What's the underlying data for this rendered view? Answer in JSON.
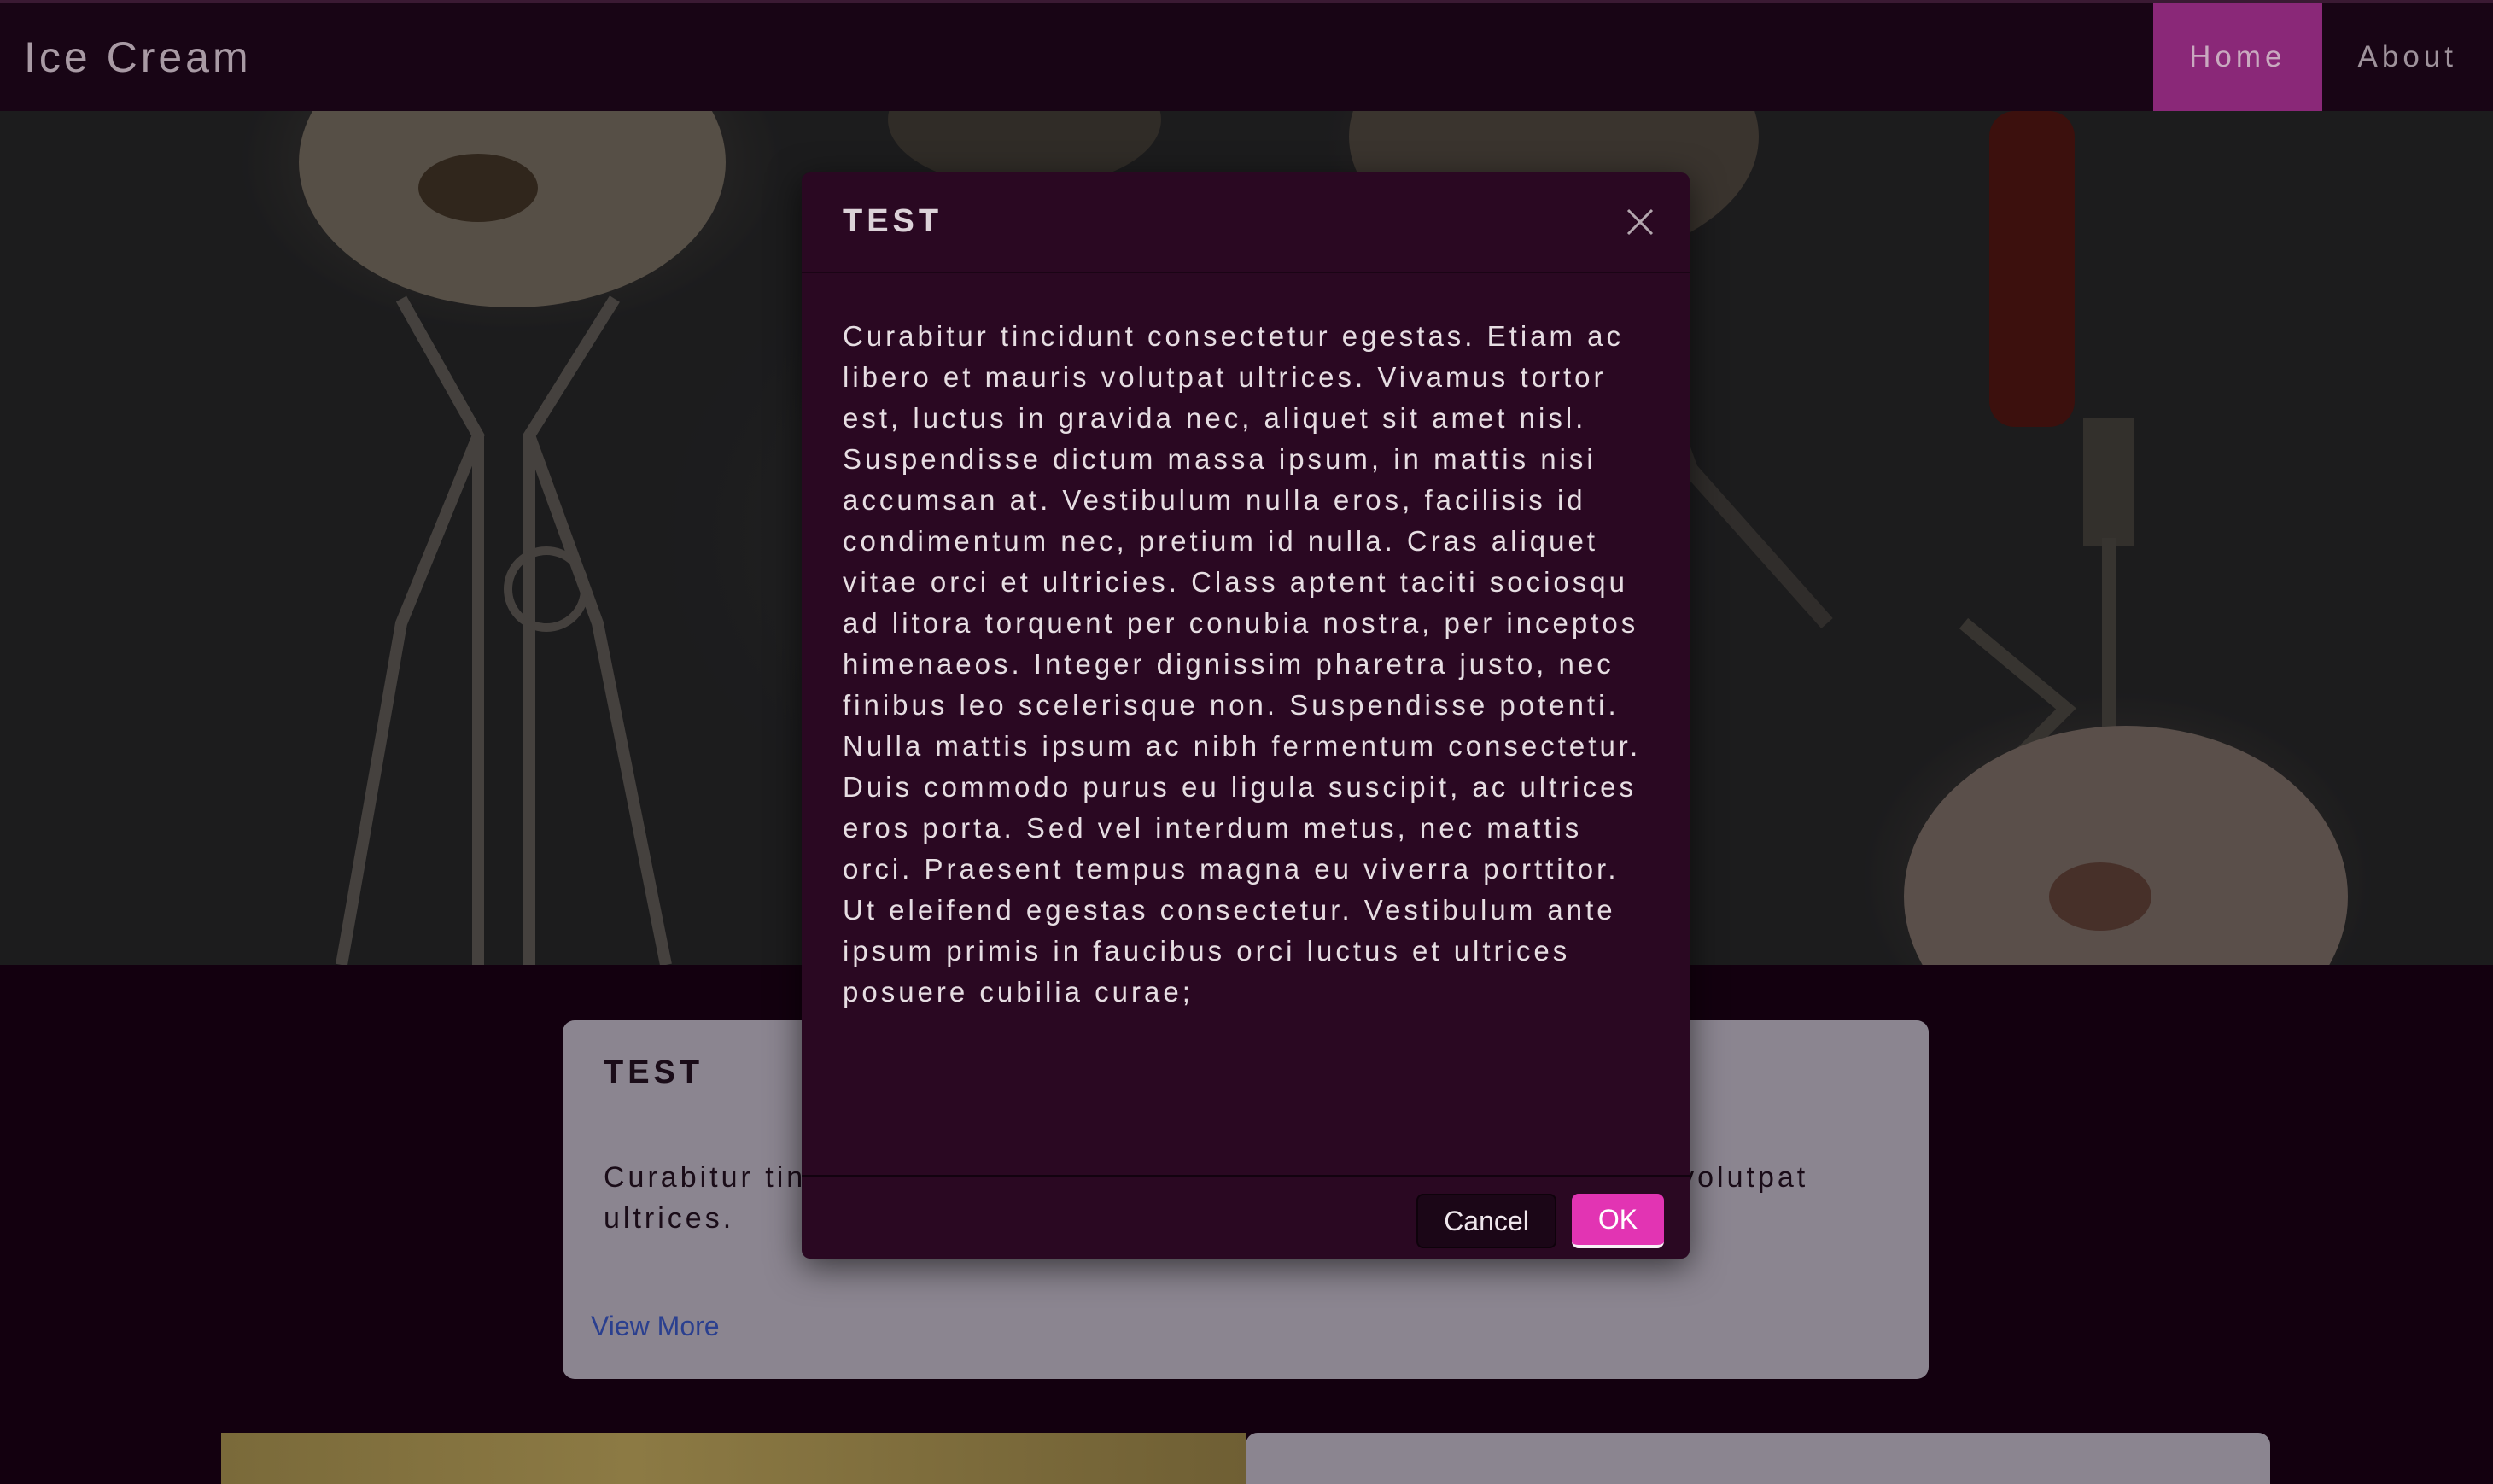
{
  "navbar": {
    "brand": "Ice Cream",
    "links": [
      {
        "label": "Home",
        "active": true
      },
      {
        "label": "About",
        "active": false
      }
    ]
  },
  "card": {
    "title": "TEST",
    "text": "Curabitur tincidunt consectetur egestas. Etiam ac libero et mauris volutpat ultrices.",
    "link_label": "View More"
  },
  "modal": {
    "title": "TEST",
    "body": "Curabitur tincidunt consectetur egestas. Etiam ac libero et mauris volutpat ultrices. Vivamus tortor est, luctus in gravida nec, aliquet sit amet nisl. Suspendisse dictum massa ipsum, in mattis nisi accumsan at. Vestibulum nulla eros, facilisis id condimentum nec, pretium id nulla. Cras aliquet vitae orci et ultricies. Class aptent taciti sociosqu ad litora torquent per conubia nostra, per inceptos himenaeos. Integer dignissim pharetra justo, nec finibus leo scelerisque non. Suspendisse potenti. Nulla mattis ipsum ac nibh fermentum consectetur. Duis commodo purus eu ligula suscipit, ac ultrices eros porta. Sed vel interdum metus, nec mattis orci. Praesent tempus magna eu viverra porttitor. Ut eleifend egestas consectetur. Vestibulum ante ipsum primis in faucibus orci luctus et ultrices posuere cubilia curae;",
    "cancel_label": "Cancel",
    "ok_label": "OK",
    "close_icon": "close-icon"
  },
  "colors": {
    "accent": "#e234b3",
    "nav_active": "#8a2878",
    "modal_bg": "#2a0822",
    "page_bg": "#13000f"
  }
}
